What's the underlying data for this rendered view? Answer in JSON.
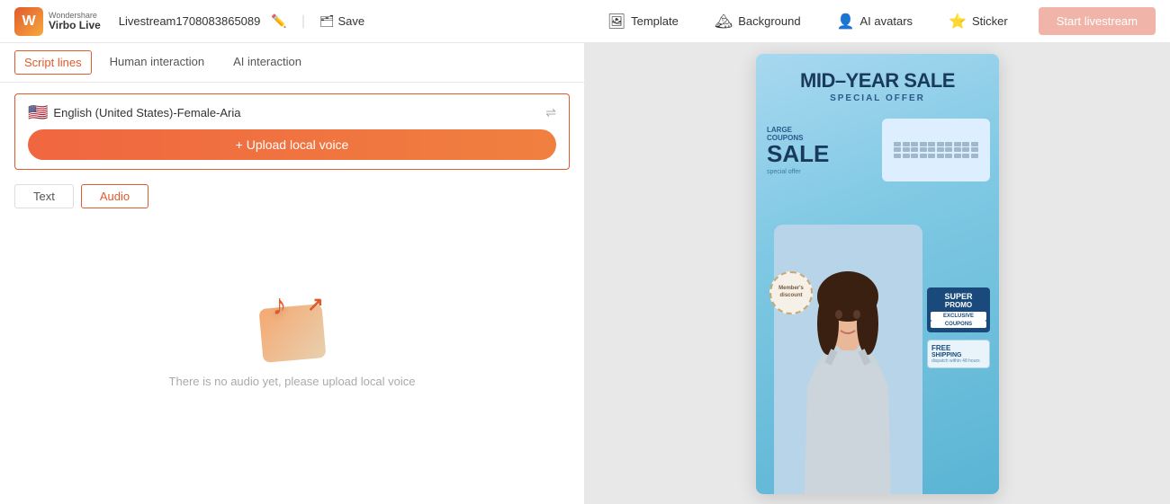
{
  "app": {
    "logo_brand1": "Wondershare",
    "logo_brand2": "Virbo Live",
    "project_name": "Livestream1708083865089",
    "save_label": "Save",
    "start_label": "Start livestream"
  },
  "nav": {
    "template_label": "Template",
    "background_label": "Background",
    "ai_avatars_label": "AI avatars",
    "sticker_label": "Sticker"
  },
  "tabs": {
    "script_lines": "Script lines",
    "human_interaction": "Human interaction",
    "ai_interaction": "AI interaction"
  },
  "sub_tabs": {
    "text": "Text",
    "audio": "Audio"
  },
  "voice": {
    "language": "English (United States)-Female-Aria",
    "flag": "🇺🇸",
    "upload_label": "+ Upload local voice"
  },
  "empty_state": {
    "message": "There is no audio yet, please upload local voice"
  },
  "poster": {
    "title": "MID–YEAR SALE",
    "subtitle": "SPECIAL OFFER",
    "large": "LARGE",
    "coupons": "COUPONS",
    "sale": "SALE",
    "special_offer": "special offer",
    "super": "SUPER",
    "promo": "PROMO",
    "exclusive": "EXCLUSIVE",
    "coupons2": "COUPONS",
    "free": "FREE",
    "shipping": "SHIPPING",
    "ship_desc": "dispatch within 48 hours",
    "member": "Member's discount"
  }
}
